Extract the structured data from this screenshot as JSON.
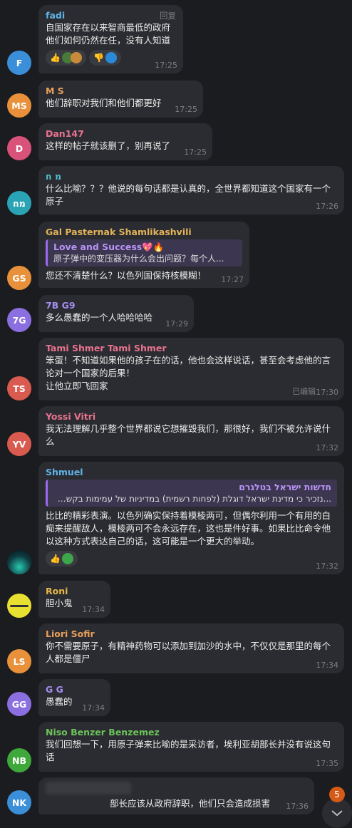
{
  "messages": [
    {
      "name": "fadi",
      "name_color": "#5fb3e8",
      "avatar": "F",
      "avatar_color": "#3a8fd8",
      "text": "自国家存在以来智商最低的政府\n他们如何仍然在任，没有人知道",
      "time": "17:25",
      "reply_label": "回复",
      "reactions": [
        "👍",
        "🙂",
        "👎",
        "🙂"
      ]
    },
    {
      "name": "M S",
      "name_color": "#e8a05a",
      "avatar": "MS",
      "avatar_color": "#e8913a",
      "text": "他们辞职对我们和他们都更好",
      "time": "17:25"
    },
    {
      "name": "Dan147",
      "name_color": "#e8738f",
      "avatar": "D",
      "avatar_color": "#d9527a",
      "text": "这样的帖子就该删了，别再说了",
      "time": "17:25"
    },
    {
      "name": "מ ח",
      "name_color": "#4fc0c8",
      "avatar": "מח",
      "avatar_color": "#2aa3b5",
      "text": "什么比喻？？？他说的每句话都是认真的，全世界都知道这个国家有一个原子",
      "time": "17:26"
    },
    {
      "name": "Gal Pasternak Shamlikashvili",
      "name_color": "#e2b35a",
      "avatar": "GS",
      "avatar_color": "#e8913a",
      "quote_title": "Love and Success💖🔥",
      "quote_text": "原子弹中的变压器为什么会出问题？每个人...",
      "text": "您还不清楚什么？以色列国保持核模糊！",
      "time": "17:27"
    },
    {
      "name": "7B G9",
      "name_color": "#a58cf0",
      "avatar": "7G",
      "avatar_color": "#8b6fe0",
      "text": "多么愚蠢的一个人哈哈哈哈",
      "time": "17:29"
    },
    {
      "name": "Tami Shmer Tami Shmer",
      "name_color": "#e8738f",
      "avatar": "TS",
      "avatar_color": "#d95a4e",
      "text": "笨蛋！不知道如果他的孩子在的话，他也会这样说话，甚至会考虑他的言论对一个国家的后果！\n让他立即飞回家",
      "time": "17:30",
      "edited": "已编辑"
    },
    {
      "name": "Yossi Vitri",
      "name_color": "#e8738f",
      "avatar": "YV",
      "avatar_color": "#d95a4e",
      "text": "我无法理解几乎整个世界都说它想摧毁我们，那很好，我们不被允许说什么",
      "time": "17:32"
    },
    {
      "name": "Shmuel",
      "name_color": "#5fb3e8",
      "avatar": "",
      "avatar_color": "#1a5a5a",
      "quote_title": "חדשות ישראל בטלגרם",
      "quote_text": "...נזכיר כי מדינת ישראל דוגלת (לפחות רשמית) במדיניות של עמימות בקשר לנו",
      "text": "比比的精彩表演。以色列确实保持着模棱两可，但偶尔利用一个有用的白痴来提醒敌人，模棱两可不会永远存在，这也是件好事。如果比比命令他以这种方式表达自己的话，这可能是一个更大的举动。",
      "time": "17:32",
      "reactions": [
        "👍",
        "🙂"
      ]
    },
    {
      "name": "Roni",
      "name_color": "#e8b84a",
      "avatar": "",
      "avatar_color": "#e8e030",
      "text": "胆小鬼",
      "time": "17:34"
    },
    {
      "name": "Liori Sofir",
      "name_color": "#e8a05a",
      "avatar": "LS",
      "avatar_color": "#e8913a",
      "text": "你不需要原子，有精神药物可以添加到加沙的水中，不仅仅是那里的每个人都是僵尸",
      "time": "17:34"
    },
    {
      "name": "G G",
      "name_color": "#a58cf0",
      "avatar": "GG",
      "avatar_color": "#8b6fe0",
      "text": "愚蠢的",
      "time": "17:34"
    },
    {
      "name": "Niso Benzer Benzemez",
      "name_color": "#6cc35a",
      "avatar": "NB",
      "avatar_color": "#3fa83a",
      "text": "我们回想一下，用原子弹来比喻的是采访者，埃利亚胡部长并没有说这句话",
      "time": "17:35"
    },
    {
      "name": "",
      "name_color": "#5fb3e8",
      "avatar": "NK",
      "avatar_color": "#3a8fd8",
      "text": "部长应该从政府辞职，他们只会造成损害",
      "time": "17:36"
    }
  ],
  "scroll": {
    "badge": "5",
    "icon": "chevron-down-icon"
  }
}
